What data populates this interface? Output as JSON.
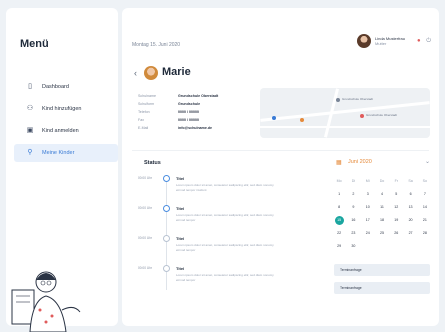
{
  "sidebar": {
    "title": "Menü",
    "items": [
      {
        "label": "Dashboard",
        "icon": "dashboard-icon",
        "active": false
      },
      {
        "label": "Kind hinzufügen",
        "icon": "add-child-icon",
        "active": false
      },
      {
        "label": "Kind anmelden",
        "icon": "register-icon",
        "active": false
      },
      {
        "label": "Meine Kinder",
        "icon": "children-icon",
        "active": true
      }
    ]
  },
  "header": {
    "date": "Montag 15. Juni 2020",
    "user_name": "Linda Musterfrau",
    "user_role": "Mutter"
  },
  "profile": {
    "name": "Marie",
    "info": [
      {
        "key": "Schulname",
        "value": "Grundschule Oberstadt"
      },
      {
        "key": "Schulform",
        "value": "Grundschule"
      },
      {
        "key": "Telefon",
        "value": "0000 / 00000"
      },
      {
        "key": "Fax",
        "value": "0000 / 00000"
      },
      {
        "key": "E-Mail",
        "value": "info@schulname.de"
      }
    ],
    "map_labels": [
      "Grundschule Oberstadt",
      "Grundschule Oberstadt"
    ]
  },
  "status": {
    "title": "Status",
    "entries": [
      {
        "time": "00:00 Uhr",
        "title": "Titel",
        "text": "Lorem ipsum dolor sit amet, consetetur sadipscing elitr, sed diam nonumy eirmod tempor invidunt",
        "done": true
      },
      {
        "time": "00:00 Uhr",
        "title": "Titel",
        "text": "Lorem ipsum dolor sit amet, consetetur sadipscing elitr, sed diam nonumy eirmod tempor",
        "done": true
      },
      {
        "time": "00:00 Uhr",
        "title": "Titel",
        "text": "Lorem ipsum dolor sit amet, consetetur sadipscing elitr, sed diam nonumy eirmod tempor",
        "done": false
      },
      {
        "time": "00:00 Uhr",
        "title": "Titel",
        "text": "Lorem ipsum dolor sit amet, consetetur sadipscing elitr, sed diam nonumy eirmod tempor",
        "done": false
      }
    ]
  },
  "calendar": {
    "month": "Juni 2020",
    "weekdays": [
      "Mo",
      "Di",
      "Mi",
      "Do",
      "Fr",
      "Sa",
      "So"
    ],
    "days": [
      {
        "d": "1",
        "m": false
      },
      {
        "d": "2",
        "m": false
      },
      {
        "d": "3",
        "m": false
      },
      {
        "d": "4",
        "m": false
      },
      {
        "d": "5",
        "m": false
      },
      {
        "d": "6",
        "m": false
      },
      {
        "d": "7",
        "m": false
      },
      {
        "d": "8",
        "m": false
      },
      {
        "d": "9",
        "m": false
      },
      {
        "d": "10",
        "m": false
      },
      {
        "d": "11",
        "m": false
      },
      {
        "d": "12",
        "m": false
      },
      {
        "d": "13",
        "m": false
      },
      {
        "d": "14",
        "m": false
      },
      {
        "d": "15",
        "m": false,
        "today": true
      },
      {
        "d": "16",
        "m": false
      },
      {
        "d": "17",
        "m": false
      },
      {
        "d": "18",
        "m": false
      },
      {
        "d": "19",
        "m": false
      },
      {
        "d": "20",
        "m": false
      },
      {
        "d": "21",
        "m": false
      },
      {
        "d": "22",
        "m": false
      },
      {
        "d": "23",
        "m": false
      },
      {
        "d": "24",
        "m": false
      },
      {
        "d": "25",
        "m": false
      },
      {
        "d": "26",
        "m": false
      },
      {
        "d": "27",
        "m": false
      },
      {
        "d": "28",
        "m": false
      },
      {
        "d": "29",
        "m": false
      },
      {
        "d": "30",
        "m": false
      }
    ]
  },
  "events": [
    "Terminanfrage",
    "Terminanfrage"
  ],
  "colors": {
    "accent": "#3a7bd5",
    "calendar": "#e58a3b",
    "today": "#1aa6a0"
  }
}
